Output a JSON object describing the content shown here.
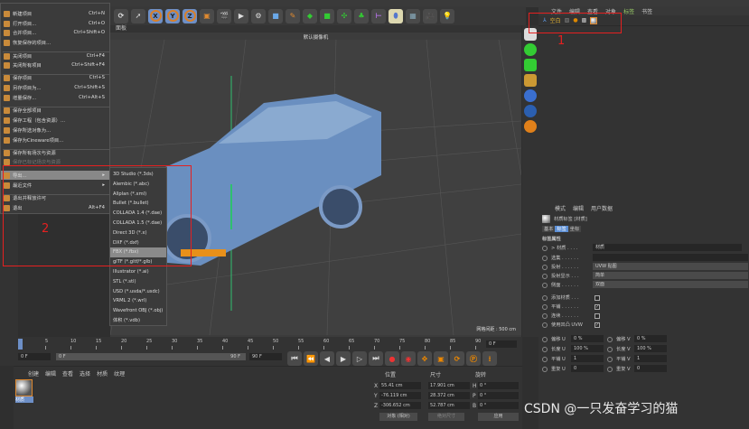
{
  "file_menu": [
    {
      "label": "新建项目",
      "shortcut": "Ctrl+N"
    },
    {
      "label": "打开项目...",
      "shortcut": "Ctrl+O"
    },
    {
      "label": "合并项目...",
      "shortcut": "Ctrl+Shift+O"
    },
    {
      "label": "恢复保存的项目...",
      "shortcut": ""
    },
    {
      "label": "关闭项目",
      "shortcut": "Ctrl+F4"
    },
    {
      "label": "关闭所有项目",
      "shortcut": "Ctrl+Shift+F4"
    },
    {
      "label": "保存项目",
      "shortcut": "Ctrl+S"
    },
    {
      "label": "另存项目为...",
      "shortcut": "Ctrl+Shift+S"
    },
    {
      "label": "增量保存...",
      "shortcut": "Ctrl+Alt+S"
    },
    {
      "label": "保存全部项目",
      "shortcut": ""
    },
    {
      "label": "保存工程（包含资源）...",
      "shortcut": ""
    },
    {
      "label": "保存所选对象为...",
      "shortcut": ""
    },
    {
      "label": "保存为Cineware项目...",
      "shortcut": ""
    },
    {
      "label": "保存所有场次与资源",
      "shortcut": ""
    },
    {
      "label": "保存已标记场次与资源",
      "shortcut": "",
      "disabled": true
    },
    {
      "label": "导出...",
      "shortcut": "",
      "highlighted": true,
      "submenu": true
    },
    {
      "label": "最近文件",
      "shortcut": "",
      "submenu": true
    },
    {
      "label": "退出并释放许可",
      "shortcut": ""
    },
    {
      "label": "退出",
      "shortcut": "Alt+F4"
    }
  ],
  "export_submenu": [
    "3D Studio (*.3ds)",
    "Alembic (*.abc)",
    "Allplan (*.xml)",
    "Bullet (*.bullet)",
    "COLLADA 1.4 (*.dae)",
    "COLLADA 1.5 (*.dae)",
    "Direct 3D (*.x)",
    "DXF (*.dxf)",
    "FBX (*.fbx)",
    "glTF (*.gltf/*.glb)",
    "Illustrator (*.ai)",
    "STL (*.stl)",
    "USD (*.usda/*.usdc)",
    "VRML 2 (*.wrl)",
    "Wavefront OBJ (*.obj)",
    "体积 (*.vdb)"
  ],
  "export_selected": "FBX (*.fbx)",
  "annotations": {
    "label1": "1",
    "label2": "2"
  },
  "viewport": {
    "panel_menu": "面板",
    "camera": "默认摄像机",
    "grid_info": "网格间距 : 500 cm"
  },
  "object_manager": {
    "menu": [
      "文件",
      "编辑",
      "查看",
      "对象",
      "标签",
      "书签"
    ],
    "object_name": "空白"
  },
  "attributes": {
    "menu": [
      "模式",
      "编辑",
      "用户数据"
    ],
    "title": "材质标签 [材质]",
    "tabs": [
      "基本",
      "标签",
      "坐标"
    ],
    "active_tab": "标签",
    "section": "标签属性",
    "material_label": "> 材质 . . . .",
    "material_value": "材质",
    "selection_label": "选集 . . . . . .",
    "projection_label": "投射 . . . . . .",
    "projection_value": "UVW 贴图",
    "projection_display_label": "投射显示 . . .",
    "projection_display_value": "简单",
    "side_label": "侧面 . . . . . .",
    "side_value": "双面",
    "add_material_label": "添加材质 . . .",
    "tile_label": "平铺 . . . . . .",
    "seamless_label": "连续 . . . . . .",
    "use_uvw_label": "使用凹凸 UVW",
    "offset_u": "偏移 U",
    "offset_u_val": "0 %",
    "offset_v": "偏移 V",
    "offset_v_val": "0 %",
    "length_u": "长度 U",
    "length_u_val": "100 %",
    "length_v": "长度 V",
    "length_v_val": "100 %",
    "tiles_u": "平铺 U",
    "tiles_u_val": "1",
    "tiles_v": "平铺 V",
    "tiles_v_val": "1",
    "repeat_u": "重复 U",
    "repeat_u_val": "0",
    "repeat_v": "重复 V",
    "repeat_v_val": "0"
  },
  "timeline": {
    "ticks": [
      "0",
      "5",
      "10",
      "15",
      "20",
      "25",
      "30",
      "35",
      "40",
      "45",
      "50",
      "55",
      "60",
      "65",
      "70",
      "75",
      "80",
      "85",
      "90"
    ],
    "current_frame": "0 F",
    "start": "0 F",
    "range_start": "0 F",
    "range_end": "90 F",
    "end": "90 F"
  },
  "material_manager": {
    "menu": [
      "创建",
      "编辑",
      "查看",
      "选择",
      "材质",
      "纹理"
    ],
    "material_name": "材质"
  },
  "coordinates": {
    "headers": [
      "位置",
      "尺寸",
      "旋转"
    ],
    "pos": {
      "x": "55.41 cm",
      "y": "-76.119 cm",
      "z": "-306.652 cm"
    },
    "size": {
      "x": "17.901 cm",
      "y": "28.372 cm",
      "z": "52.787 cm"
    },
    "rot": {
      "h": "0 °",
      "p": "0 °",
      "b": "0 °"
    },
    "axis_labels": {
      "x": "X",
      "y": "Y",
      "z": "Z",
      "h": "H",
      "p": "P",
      "b": "B"
    },
    "mode": "对象 (相对)",
    "size_mode": "绝对尺寸",
    "apply": "应用"
  },
  "watermark": "CSDN @一只发奋学习的猫"
}
